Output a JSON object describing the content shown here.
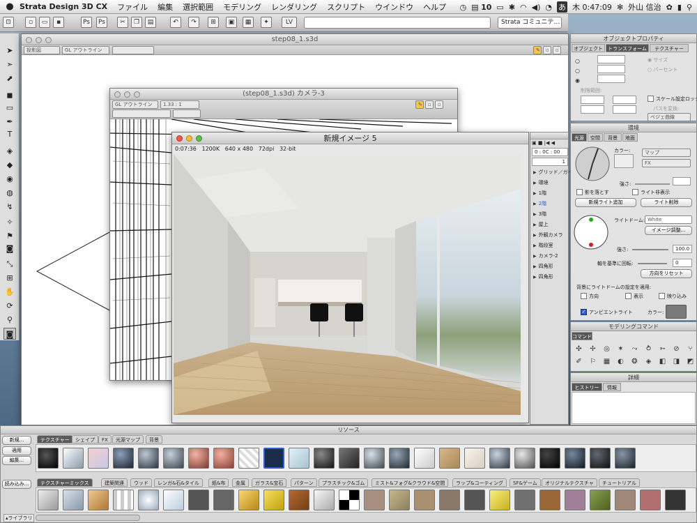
{
  "menubar": {
    "app_name": "Strata Design 3D CX",
    "items": [
      "ファイル",
      "編集",
      "選択範囲",
      "モデリング",
      "レンダリング",
      "スクリプト",
      "ウインドウ",
      "ヘルプ"
    ],
    "status": {
      "adobe_count": "10",
      "ime": "あ",
      "clock": "木 0:47:09",
      "user": "外山 信治"
    }
  },
  "toolbar": {
    "community_label": "Strata コミュニテ…"
  },
  "main_window": {
    "title": "step08_1.s3d",
    "render_mode": "投影図",
    "shading": "GL アウトライン"
  },
  "camera_window": {
    "title": "(step08_1.s3d) カメラ-3",
    "shading": "GL アウトライン",
    "ratio": "1.33 : 1"
  },
  "render_window": {
    "title": "新規イメージ 5",
    "time": "0:07:36",
    "size": "1200K",
    "dims": "640 x 480",
    "dpi": "72dpi",
    "bits": "32-bit"
  },
  "timeline": {
    "time": "0 : 0C : 00",
    "frame": "1",
    "items": [
      "グリッド／ガイ",
      "環境",
      "1階",
      "2階",
      "3階",
      "屋上",
      "外観カメラ",
      "階段室",
      "カメラ-2",
      "四角形",
      "四角形"
    ]
  },
  "object_props": {
    "title": "オブジェクトプロパティ",
    "tabs": [
      "オブジェクト",
      "トランスフォーム",
      "テクスチャー"
    ],
    "size_label": "サイズ",
    "percent_label": "パーセント",
    "clamp_label": "制限範囲:",
    "scale_lock": "スケール設定ロック",
    "path_convert": "パスを変換:",
    "bezier": "ベジェ曲線"
  },
  "environment": {
    "title": "環境",
    "tabs": [
      "光源",
      "空間",
      "背景",
      "地面"
    ],
    "color_label": "カラー:",
    "map_label": "マップ",
    "fx_label": "FX",
    "strength_label": "強さ:",
    "cast_shadow": "影を落とす",
    "show_light": "ライト非表示",
    "new_light": "新規ライト追加",
    "delete_light": "ライト削除",
    "light_dome_label": "ライトドーム:",
    "light_dome_value": "White",
    "image_adjust": "イメージ調整...",
    "dome_strength_label": "強さ:",
    "dome_strength_value": "100.0",
    "rotate_label": "軸を基準に回転:",
    "rotate_value": "0",
    "reset_dir": "方向をリセット",
    "apply_label": "背景にライトドームの設定を適用:",
    "opt_direction": "方向",
    "opt_display": "表示",
    "opt_reflect": "映り込み",
    "ambient": "アンビエントライト",
    "ambient_color_label": "カラー:"
  },
  "modeling": {
    "title": "モデリングコマンド",
    "tab": "コマンド"
  },
  "details": {
    "title": "詳細",
    "tabs": [
      "ヒストリー",
      "情報"
    ]
  },
  "resources": {
    "title": "リソース",
    "buttons": [
      "新規...",
      "適用",
      "編集...",
      "読み込み..."
    ],
    "tabs": [
      "テクスチャー",
      "シェイプ",
      "FX",
      "光源マップ",
      "背景"
    ],
    "library_label": "ライブラリ",
    "library_tabs": [
      "テクスチャーミックス",
      "建築関連",
      "ウッド",
      "レンガ&石&タイル",
      "紙&布",
      "金属",
      "ガラス&宝石",
      "パターン",
      "プラスチック&ゴム",
      "ミスト&フォグ&クラウド&空間",
      "ラップ&コーティング",
      "SF&ゲーム",
      "オリジナルテクスチャ",
      "チュートリアル"
    ]
  },
  "colors": {
    "accent_blue": "#2e5fd2",
    "panel_bg": "#e3e3e3",
    "titlebar": "#c9c9c9"
  }
}
